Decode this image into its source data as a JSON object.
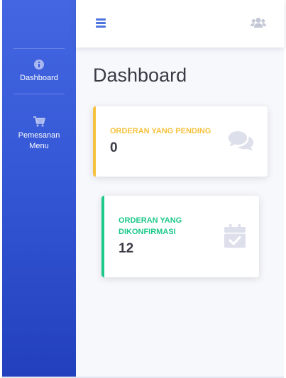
{
  "sidebar": {
    "items": [
      {
        "label": "Dashboard",
        "icon": "info-circle-icon"
      },
      {
        "label": "Pemesanan Menu",
        "icon": "shopping-cart-icon"
      }
    ]
  },
  "topbar": {
    "menu_icon": "hamburger-menu-icon",
    "user_icon": "users-icon"
  },
  "page": {
    "title": "Dashboard"
  },
  "cards": [
    {
      "label": "ORDERAN YANG PENDING",
      "value": "0",
      "accent": "#f6c23e",
      "icon": "comments-icon"
    },
    {
      "label": "ORDERAN YANG DIKONFIRMASI",
      "value": "12",
      "accent": "#1cc88a",
      "icon": "calendar-check-icon"
    }
  ],
  "colors": {
    "primary": "#4e73df",
    "text_dark": "#3a3b45",
    "icon_muted": "#dddfeb"
  }
}
